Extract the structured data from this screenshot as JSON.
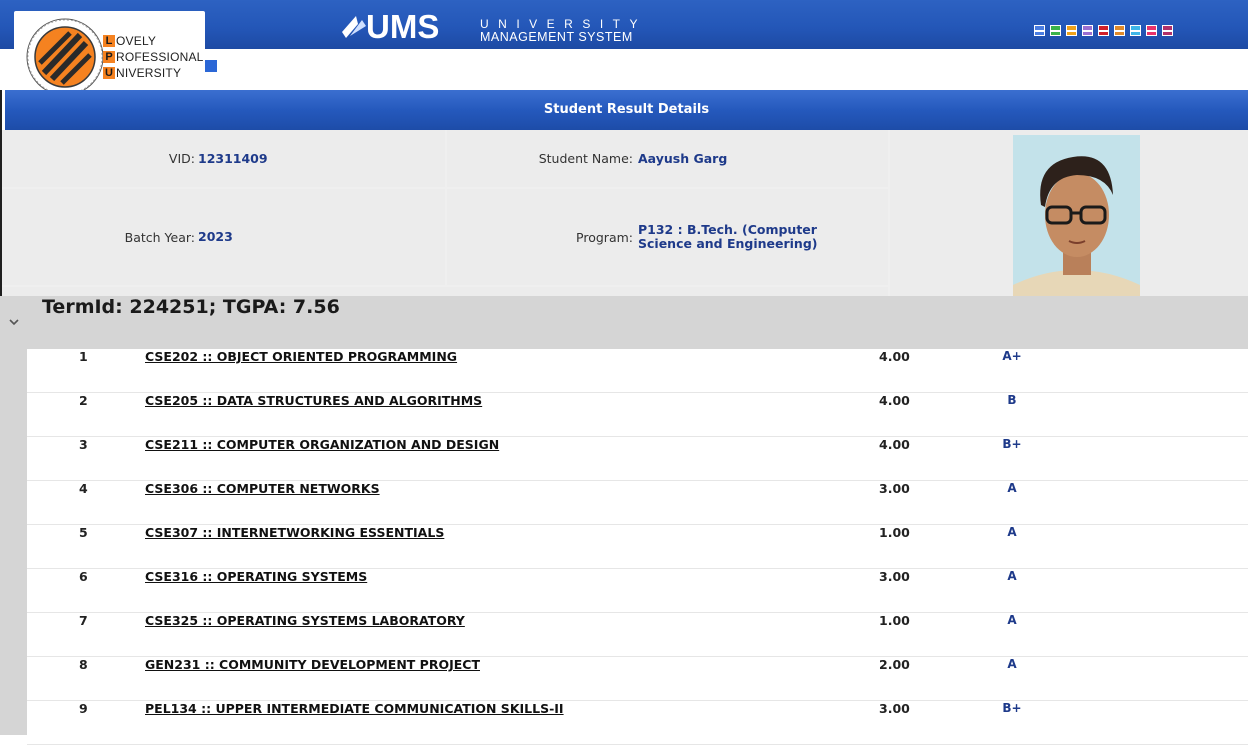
{
  "header": {
    "logo": {
      "lines": [
        {
          "initial": "L",
          "rest": "OVELY"
        },
        {
          "initial": "P",
          "rest": "ROFESSIONAL"
        },
        {
          "initial": "U",
          "rest": "NIVERSITY"
        }
      ]
    },
    "ums": {
      "mark": "UMS",
      "tagline_top": "UNIVERSITY",
      "tagline_bottom": "MANAGEMENT SYSTEM"
    },
    "theme_swatches": [
      "#4a7de0",
      "#3bb34a",
      "#f0a21a",
      "#9b6fd1",
      "#d0212a",
      "#e08a2a",
      "#3fb6e8",
      "#e8336b",
      "#b0316a"
    ]
  },
  "title_bar": {
    "title": "Student Result Details"
  },
  "details": {
    "vid_label": "VID:",
    "vid_value": "12311409",
    "name_label": "Student Name:",
    "name_value": "Aayush Garg",
    "batch_label": "Batch Year:",
    "batch_value": "2023",
    "program_label": "Program:",
    "program_value": "P132 : B.Tech. (Computer Science and Engineering)"
  },
  "term": {
    "title": "TermId: 224251; TGPA: 7.56"
  },
  "courses": [
    {
      "num": "1",
      "title": "CSE202 :: OBJECT ORIENTED PROGRAMMING",
      "credits": "4.00",
      "grade": "A+"
    },
    {
      "num": "2",
      "title": "CSE205 :: DATA STRUCTURES AND ALGORITHMS",
      "credits": "4.00",
      "grade": "B"
    },
    {
      "num": "3",
      "title": "CSE211 :: COMPUTER ORGANIZATION AND DESIGN",
      "credits": "4.00",
      "grade": "B+"
    },
    {
      "num": "4",
      "title": "CSE306 :: COMPUTER NETWORKS",
      "credits": "3.00",
      "grade": "A"
    },
    {
      "num": "5",
      "title": "CSE307 :: INTERNETWORKING ESSENTIALS",
      "credits": "1.00",
      "grade": "A"
    },
    {
      "num": "6",
      "title": "CSE316 :: OPERATING SYSTEMS",
      "credits": "3.00",
      "grade": "A"
    },
    {
      "num": "7",
      "title": "CSE325 :: OPERATING SYSTEMS LABORATORY",
      "credits": "1.00",
      "grade": "A"
    },
    {
      "num": "8",
      "title": "GEN231 :: COMMUNITY DEVELOPMENT PROJECT",
      "credits": "2.00",
      "grade": "A"
    },
    {
      "num": "9",
      "title": "PEL134 :: UPPER INTERMEDIATE COMMUNICATION SKILLS-II",
      "credits": "3.00",
      "grade": "B+"
    }
  ]
}
